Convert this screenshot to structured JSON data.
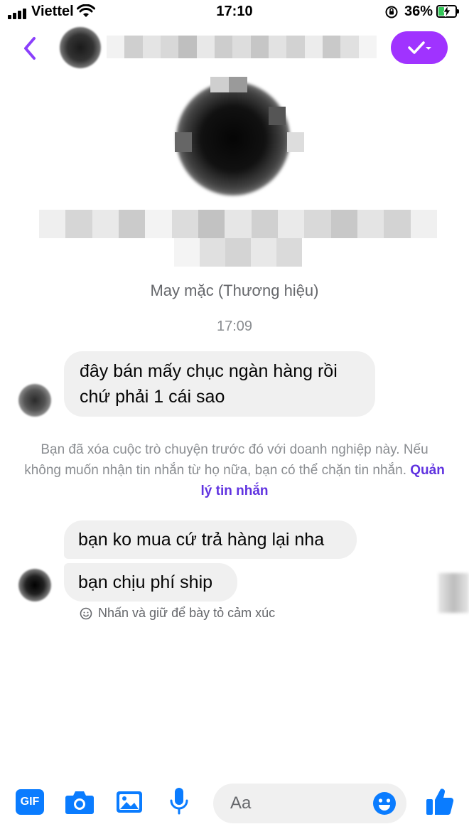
{
  "status_bar": {
    "carrier": "Viettel",
    "time": "17:10",
    "battery_percent": "36%",
    "battery_level": 0.36,
    "charging": true
  },
  "header": {
    "verified_color": "#a033ff"
  },
  "profile": {
    "category": "May mặc (Thương hiệu)"
  },
  "conversation": {
    "timestamp": "17:09",
    "messages": [
      {
        "line1": "đây bán mấy chục ngàn hàng rồi",
        "line2": "chứ phải 1 cái sao"
      },
      {
        "text": "bạn ko mua cứ trả hàng lại nha"
      },
      {
        "text": "bạn chịu phí ship"
      }
    ],
    "notice": {
      "text": "Bạn đã xóa cuộc trò chuyện trước đó với doanh nghiệp này. Nếu không muốn nhận tin nhắn từ họ nữa, bạn có thể chặn tin nhắn.",
      "link": "Quản lý tin nhắn"
    },
    "reaction_hint": "Nhấn và giữ để bày tỏ cảm xúc"
  },
  "composer": {
    "gif_label": "GIF",
    "placeholder": "Aa",
    "accent": "#0a7cff",
    "icons": [
      "gif-icon",
      "camera-icon",
      "gallery-icon",
      "microphone-icon",
      "emoji-icon",
      "thumbs-up-icon"
    ]
  }
}
